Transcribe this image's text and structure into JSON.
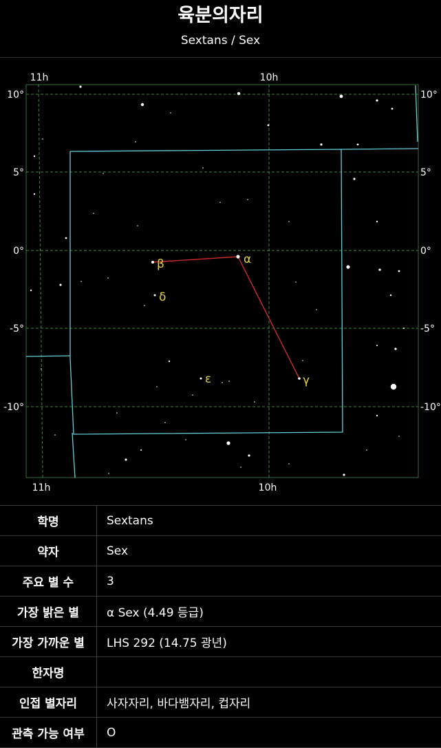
{
  "header": {
    "title": "육분의자리",
    "subtitle": "Sextans / Sex"
  },
  "star_map": {
    "ra_labels": [
      "11h",
      "10h"
    ],
    "dec_labels": [
      "10°",
      "5°",
      "0°",
      "-5°",
      "-10°"
    ],
    "colors": {
      "grid": "#3d8a3d",
      "frame": "#3a6e3a",
      "boundary": "#66d0dc",
      "lines": "#cc2a2a",
      "star_labels": "#e6d23c",
      "stars": "#ffffff"
    },
    "stars": [
      {
        "name": "alpha",
        "label": "α"
      },
      {
        "name": "beta",
        "label": "β"
      },
      {
        "name": "gamma",
        "label": "γ"
      },
      {
        "name": "delta",
        "label": "δ"
      },
      {
        "name": "epsilon",
        "label": "ε"
      }
    ]
  },
  "info": {
    "rows": [
      {
        "key": "학명",
        "value": "Sextans"
      },
      {
        "key": "약자",
        "value": "Sex"
      },
      {
        "key": "주요 별 수",
        "value": "3"
      },
      {
        "key": "가장 밝은 별",
        "value": "α Sex (4.49 등급)"
      },
      {
        "key": "가장 가까운 별",
        "value": "LHS 292 (14.75 광년)"
      },
      {
        "key": "한자명",
        "value": ""
      },
      {
        "key": "인접 별자리",
        "value": "사자자리, 바다뱀자리, 컵자리"
      },
      {
        "key": "관측 가능 여부",
        "value": "O"
      }
    ]
  }
}
